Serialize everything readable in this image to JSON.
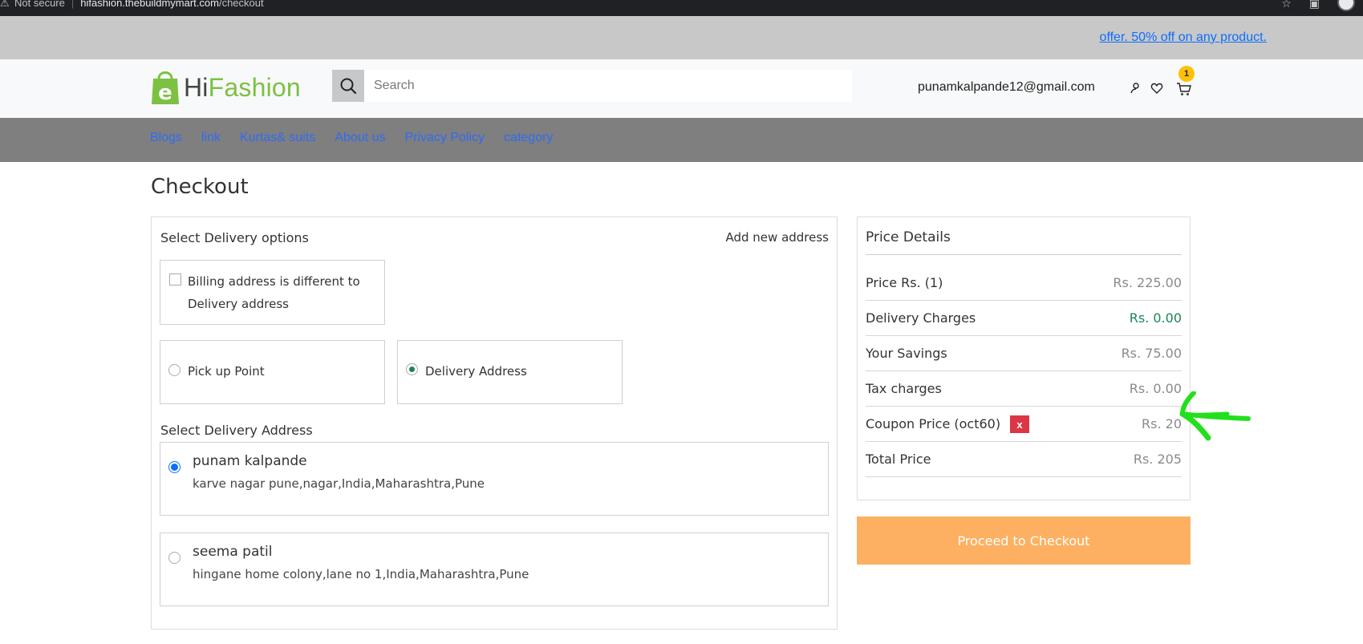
{
  "browser": {
    "security": "Not secure",
    "host": "hifashion.thebuildmymart.com",
    "path": "/checkout"
  },
  "offer": {
    "text": "offer. 50% off on any product."
  },
  "header": {
    "logo_hi": "Hi",
    "logo_fashion": "Fashion",
    "logo_mark": "e",
    "search_placeholder": "Search",
    "user_email": "punamkalpande12@gmail.com",
    "cart_count": "1"
  },
  "nav": {
    "items": [
      "Blogs",
      "link",
      "Kurtas& suits",
      "About us",
      "Privacy Policy",
      "category"
    ]
  },
  "checkout": {
    "title": "Checkout",
    "delivery_options_heading": "Select Delivery options",
    "add_new_address": "Add new address",
    "billing_checkbox_label": "Billing address is different to Delivery address",
    "pickup_label": "Pick up Point",
    "delivery_label": "Delivery Address",
    "select_address_heading": "Select Delivery Address",
    "addresses": [
      {
        "name": "punam kalpande",
        "line": "karve nagar pune,nagar,India,Maharashtra,Pune",
        "selected": true
      },
      {
        "name": "seema patil",
        "line": "hingane home colony,lane no 1,India,Maharashtra,Pune",
        "selected": false
      }
    ]
  },
  "price_details": {
    "title": "Price Details",
    "rows": [
      {
        "label": "Price Rs. (1)",
        "value": "Rs. 225.00"
      },
      {
        "label": "Delivery Charges",
        "value": "Rs. 0.00"
      },
      {
        "label": "Your Savings",
        "value": "Rs. 75.00"
      },
      {
        "label": "Tax charges",
        "value": "Rs. 0.00"
      },
      {
        "label": "Coupon Price (oct60)",
        "value": "Rs. 20"
      },
      {
        "label": "Total Price",
        "value": "Rs. 205"
      }
    ],
    "remove_coupon_label": "x",
    "proceed_label": "Proceed to Checkout"
  },
  "colors": {
    "brand_green": "#7cc142",
    "proceed_orange": "#fdb061",
    "nav_bg": "#7f7f7f",
    "link_blue": "#2f6bf5",
    "remove_red": "#dc3545",
    "annotation_green": "#22e01c"
  }
}
